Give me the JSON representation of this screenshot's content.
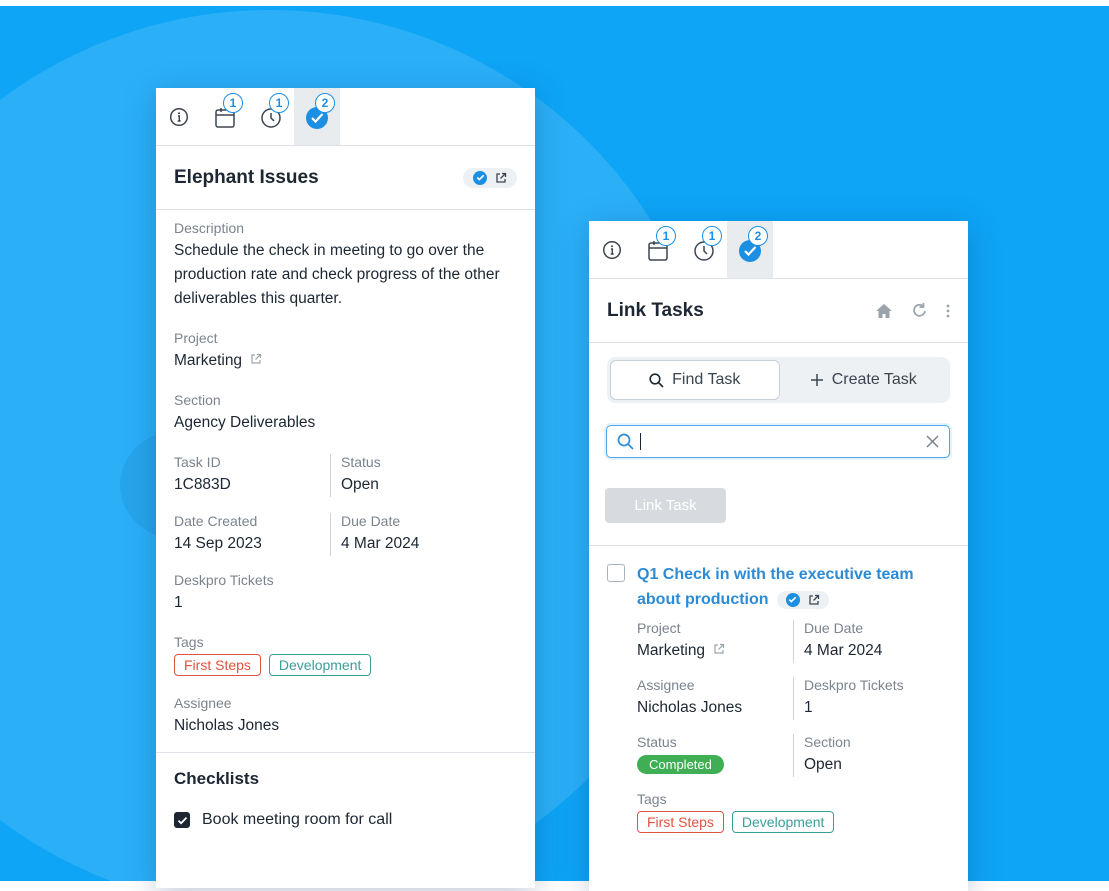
{
  "colors": {
    "background": "#0ea5f7",
    "accent": "#1c8fe3",
    "link": "#2d8bd6",
    "completed": "#3fae55",
    "tag_red": "#e0533f",
    "tag_teal": "#3a9e9a"
  },
  "left_panel": {
    "tabs": [
      {
        "icon": "info-icon"
      },
      {
        "icon": "calendar-icon",
        "badge": "1"
      },
      {
        "icon": "clock-icon",
        "badge": "1"
      },
      {
        "icon": "task-check-icon",
        "badge": "2",
        "active": true
      }
    ],
    "title": "Elephant Issues",
    "description_label": "Description",
    "description": "Schedule the check in meeting to go over the production rate and check progress of the other deliverables this quarter.",
    "project_label": "Project",
    "project": "Marketing",
    "section_label": "Section",
    "section": "Agency Deliverables",
    "task_id_label": "Task ID",
    "task_id": "1C883D",
    "status_label": "Status",
    "status": "Open",
    "date_created_label": "Date Created",
    "date_created": "14 Sep 2023",
    "due_date_label": "Due Date",
    "due_date": "4 Mar 2024",
    "tickets_label": "Deskpro Tickets",
    "tickets": "1",
    "tags_label": "Tags",
    "tags": [
      "First Steps",
      "Development"
    ],
    "assignee_label": "Assignee",
    "assignee": "Nicholas Jones",
    "checklists_title": "Checklists",
    "checklist_items": [
      {
        "label": "Book meeting room for call",
        "checked": true
      }
    ]
  },
  "right_panel": {
    "tabs": [
      {
        "icon": "info-icon"
      },
      {
        "icon": "calendar-icon",
        "badge": "1"
      },
      {
        "icon": "clock-icon",
        "badge": "1"
      },
      {
        "icon": "task-check-icon",
        "badge": "2",
        "active": true
      }
    ],
    "title": "Link Tasks",
    "find_task_label": "Find Task",
    "create_task_label": "Create Task",
    "search_value": "",
    "link_button_label": "Link Task",
    "result": {
      "title": "Q1 Check in with the executive team about production",
      "project_label": "Project",
      "project": "Marketing",
      "due_date_label": "Due Date",
      "due_date": "4 Mar 2024",
      "assignee_label": "Assignee",
      "assignee": "Nicholas Jones",
      "tickets_label": "Deskpro Tickets",
      "tickets": "1",
      "status_label": "Status",
      "status": "Completed",
      "section_label": "Section",
      "section": "Open",
      "tags_label": "Tags",
      "tags": [
        "First Steps",
        "Development"
      ]
    }
  }
}
